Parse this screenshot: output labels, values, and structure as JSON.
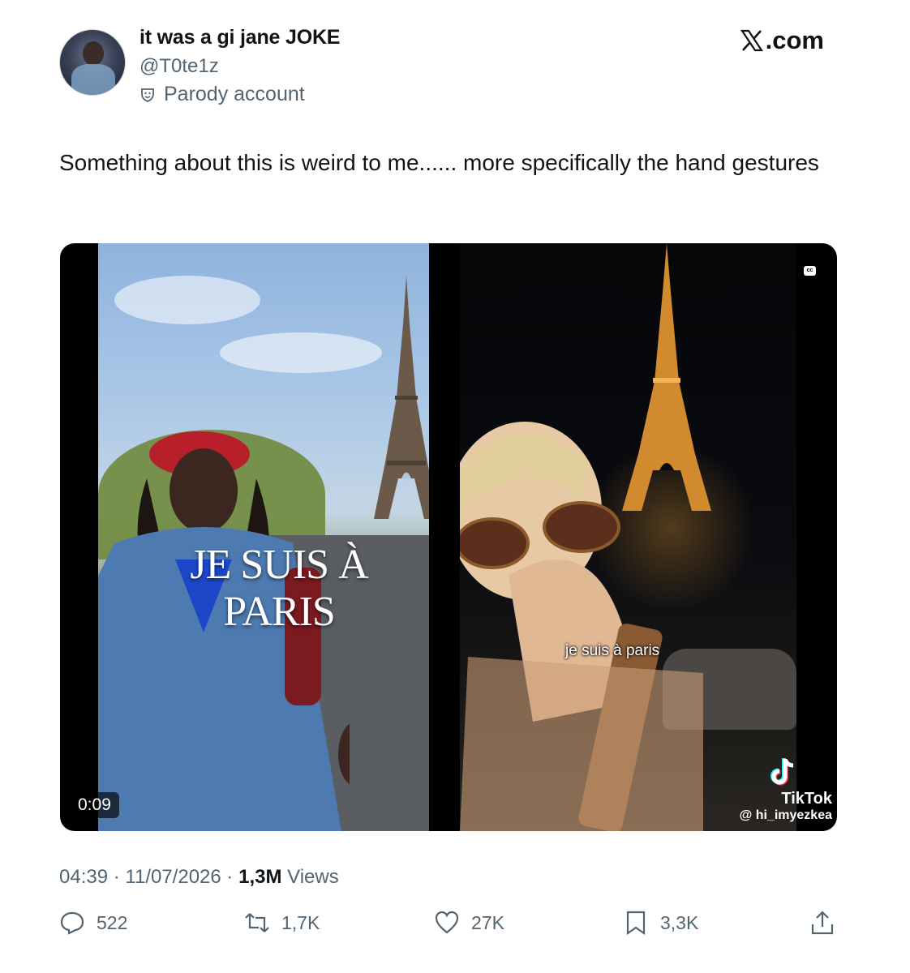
{
  "author": {
    "display_name": "it was a gi jane JOKE",
    "handle": "@T0te1z",
    "label": "Parody account"
  },
  "brand": {
    "text": ".com",
    "icon": "x-logo-icon"
  },
  "tweet": {
    "text": "Something about this is weird to me...... more specifically the hand gestures"
  },
  "media": {
    "left_overlay": "JE SUIS À PARIS",
    "right_overlay": "je suis à paris",
    "duration": "0:09",
    "captions_badge": "cc",
    "watermark_name": "TikTok",
    "watermark_handle": "@ hi_imyezkea"
  },
  "meta": {
    "time": "04:39",
    "date": "11/07/2026",
    "views_count": "1,3M",
    "views_label": "Views",
    "separator": "·"
  },
  "actions": {
    "replies": "522",
    "reposts": "1,7K",
    "likes": "27K",
    "bookmarks": "3,3K"
  },
  "colors": {
    "text_primary": "#0f1419",
    "text_secondary": "#536471"
  }
}
